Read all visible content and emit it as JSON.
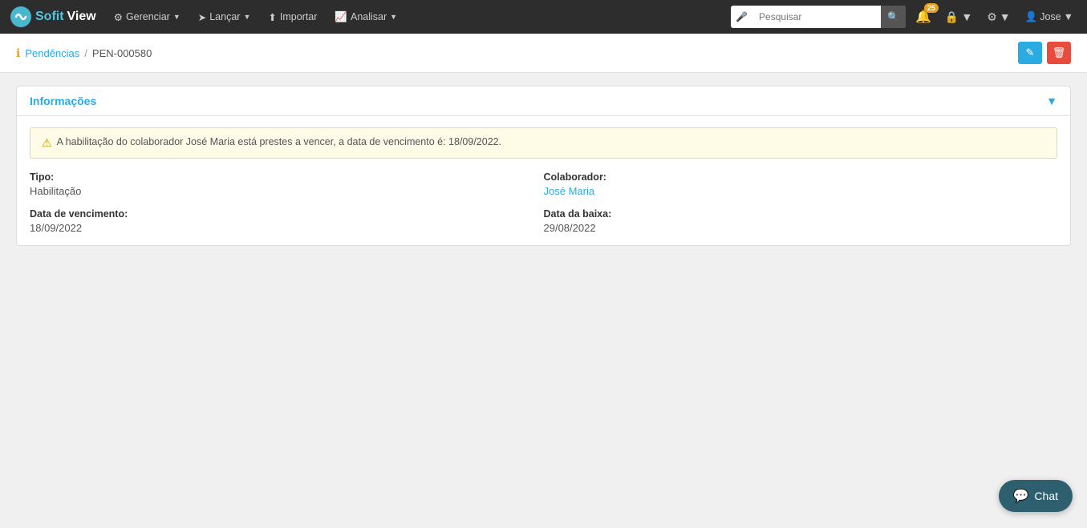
{
  "brand": {
    "sofit": "Sofit",
    "view": "View"
  },
  "navbar": {
    "items": [
      {
        "id": "gerenciar",
        "label": "Gerenciar",
        "hasDropdown": true
      },
      {
        "id": "lancar",
        "label": "Lançar",
        "hasDropdown": true
      },
      {
        "id": "importar",
        "label": "Importar",
        "hasDropdown": false
      },
      {
        "id": "analisar",
        "label": "Analisar",
        "hasDropdown": true
      }
    ],
    "search_placeholder": "Pesquisar",
    "notifications_count": "25",
    "user_name": "Jose"
  },
  "breadcrumb": {
    "parent_label": "Pendências",
    "separator": "/",
    "current": "PEN-000580"
  },
  "actions": {
    "edit_label": "✎",
    "delete_label": "🗑"
  },
  "card": {
    "title": "Informações",
    "collapse_icon": "▼"
  },
  "alert": {
    "icon": "⚠",
    "message": "A habilitação do colaborador José Maria está prestes a vencer, a data de vencimento é: 18/09/2022."
  },
  "fields": {
    "tipo_label": "Tipo:",
    "tipo_value": "Habilitação",
    "colaborador_label": "Colaborador:",
    "colaborador_value": "José Maria",
    "data_vencimento_label": "Data de vencimento:",
    "data_vencimento_value": "18/09/2022",
    "data_baixa_label": "Data da baixa:",
    "data_baixa_value": "29/08/2022"
  },
  "chat": {
    "label": "Chat"
  }
}
